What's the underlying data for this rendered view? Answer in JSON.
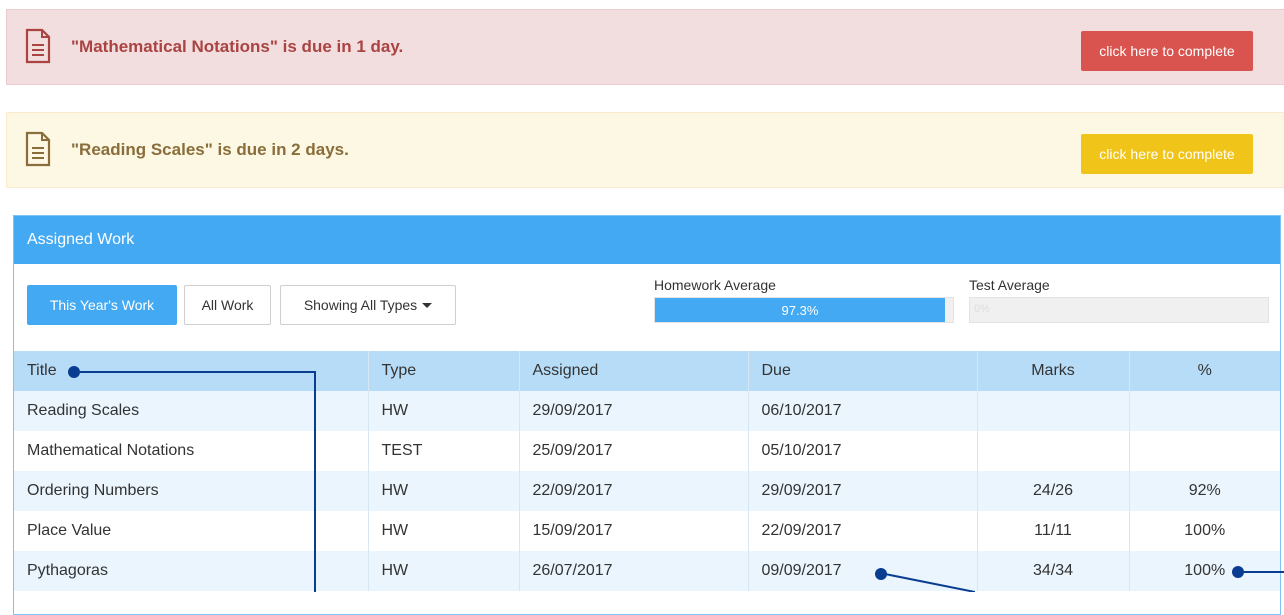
{
  "alerts": [
    {
      "message": "\"Mathematical Notations\" is due in 1 day.",
      "button": "click here to complete",
      "color": "#d9534f"
    },
    {
      "message": "\"Reading Scales\" is due in 2 days.",
      "button": "click here to complete",
      "color": "#f0c419"
    }
  ],
  "panel": {
    "title": "Assigned Work",
    "buttons": {
      "this_year": "This Year's Work",
      "all_work": "All Work",
      "types": "Showing All Types"
    },
    "homework_average": {
      "label": "Homework Average",
      "value_text": "97.3%",
      "fraction": 0.973
    },
    "test_average": {
      "label": "Test Average",
      "value_text": "0%",
      "fraction": 0
    }
  },
  "table": {
    "columns": [
      "Title",
      "Type",
      "Assigned",
      "Due",
      "Marks",
      "%"
    ],
    "rows": [
      {
        "title": "Reading Scales",
        "type": "HW",
        "assigned": "29/09/2017",
        "due": "06/10/2017",
        "marks": "",
        "percent": ""
      },
      {
        "title": "Mathematical Notations",
        "type": "TEST",
        "assigned": "25/09/2017",
        "due": "05/10/2017",
        "marks": "",
        "percent": ""
      },
      {
        "title": "Ordering Numbers",
        "type": "HW",
        "assigned": "22/09/2017",
        "due": "29/09/2017",
        "marks": "24/26",
        "percent": "92%"
      },
      {
        "title": "Place Value",
        "type": "HW",
        "assigned": "15/09/2017",
        "due": "22/09/2017",
        "marks": "11/11",
        "percent": "100%"
      },
      {
        "title": "Pythagoras",
        "type": "HW",
        "assigned": "26/07/2017",
        "due": "09/09/2017",
        "marks": "34/34",
        "percent": "100%"
      }
    ]
  },
  "colors": {
    "accent": "#42a9f2",
    "header_row": "#b7dcf7",
    "annotation": "#0a3d91"
  }
}
